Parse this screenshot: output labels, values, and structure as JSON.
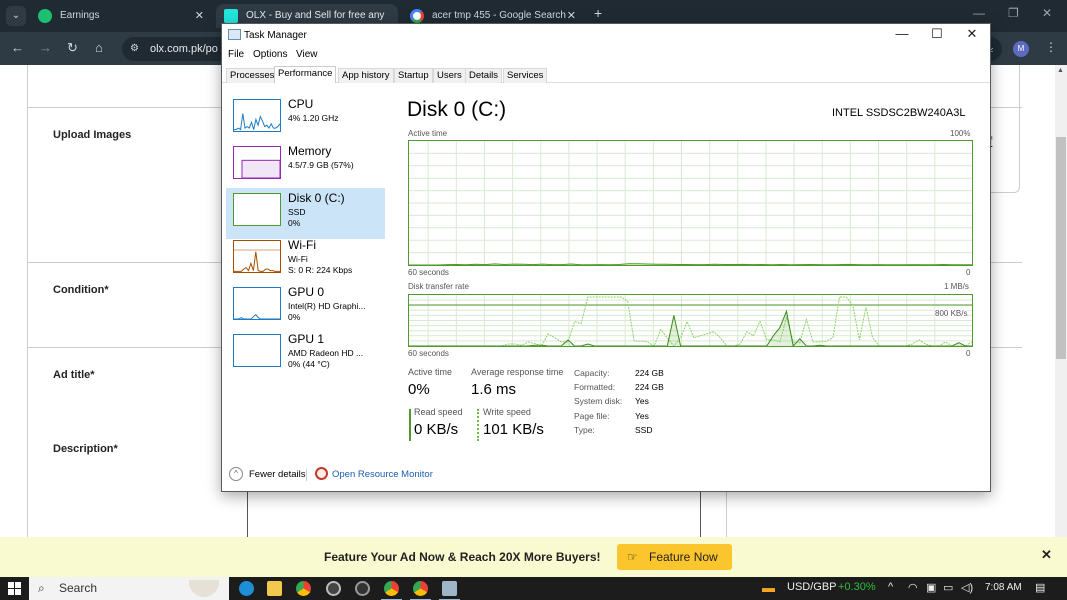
{
  "browser": {
    "tabs": [
      {
        "title": "Earnings",
        "favicon": "fiverr-icon",
        "color": "#1dbf73"
      },
      {
        "title": "OLX - Buy and Sell for free any",
        "favicon": "olx-icon",
        "color": "#23e5db"
      },
      {
        "title": "acer tmp 455 - Google Search",
        "favicon": "google-icon",
        "color": "#ffffff"
      }
    ],
    "new_tab": "+",
    "url": "olx.com.pk/po",
    "avatar_letter": "M",
    "tab_search_glyph": "⌄"
  },
  "page": {
    "labels": {
      "upload_images": "Upload Images",
      "condition": "Condition*",
      "ad_title": "Ad title*",
      "description": "Description*"
    },
    "partial_text": "f"
  },
  "banner": {
    "text": "Feature Your Ad Now & Reach 20X More Buyers!",
    "button": "Feature Now",
    "close": "✕"
  },
  "task_manager": {
    "title": "Task Manager",
    "menu": [
      "File",
      "Options",
      "View"
    ],
    "tabs": [
      "Processes",
      "Performance",
      "App history",
      "Startup",
      "Users",
      "Details",
      "Services"
    ],
    "active_tab": "Performance",
    "sidebar": [
      {
        "name": "CPU",
        "sub1": "4% 1.20 GHz",
        "sub2": "",
        "color": "#1e7bc3",
        "selected": false,
        "spark": [
          0.05,
          0.05,
          0.1,
          0.05,
          0.6,
          0.1,
          0.15,
          0.1,
          0.3,
          0.05,
          0.4,
          0.2,
          0.5,
          0.35,
          0.15,
          0.2,
          0.1,
          0.25,
          0.1,
          0.1,
          0.15,
          0.25
        ]
      },
      {
        "name": "Memory",
        "sub1": "4.5/7.9 GB (57%)",
        "sub2": "",
        "color": "#9528b4",
        "selected": false,
        "spark": [
          0.57
        ]
      },
      {
        "name": "Disk 0 (C:)",
        "sub1": "SSD",
        "sub2": "0%",
        "color": "#4e9a2a",
        "selected": true,
        "spark": [
          0
        ]
      },
      {
        "name": "Wi-Fi",
        "sub1": "Wi-Fi",
        "sub2": "S: 0 R: 224 Kbps",
        "color": "#a74f01",
        "selected": false,
        "spark": [
          0.02,
          0.02,
          0.02,
          0.02,
          0.1,
          0.15,
          0.05,
          0.3,
          0.05,
          0.7,
          0.05,
          0.02,
          0.02,
          0.1,
          0.1,
          0.05,
          0.05,
          0.02,
          0.02,
          0.02
        ]
      },
      {
        "name": "GPU 0",
        "sub1": "Intel(R) HD Graphi...",
        "sub2": "0%",
        "color": "#1e7bc3",
        "selected": false,
        "spark": [
          0,
          0,
          0,
          0.05,
          0,
          0,
          0,
          0,
          0.08,
          0.15,
          0.05,
          0,
          0,
          0,
          0,
          0,
          0,
          0,
          0,
          0
        ]
      },
      {
        "name": "GPU 1",
        "sub1": "AMD Radeon HD ...",
        "sub2": "0% (44 °C)",
        "color": "#1e7bc3",
        "selected": false,
        "spark": [
          0
        ]
      }
    ],
    "detail": {
      "title": "Disk 0 (C:)",
      "model": "INTEL SSDSC2BW240A3L",
      "active_time_label": "Active time",
      "active_time_max": "100%",
      "time_span_label": "60 seconds",
      "min_label": "0",
      "transfer_label": "Disk transfer rate",
      "transfer_max": "1 MB/s",
      "transfer_mid": "800 KB/s",
      "active_series": [
        0,
        0,
        0,
        0,
        0.3,
        0.4,
        0.2,
        0.6,
        0.3,
        0.9,
        0.4,
        0.7,
        0.6,
        0.3,
        0.7,
        0.3,
        0.3,
        0.8,
        0.2,
        0.2,
        0.3,
        0.2,
        0.4,
        1.0,
        1.0,
        0.8,
        0.6,
        0.6,
        0.4,
        0.4,
        0.3,
        0.3,
        0.6,
        0.4,
        0.4,
        0.5,
        0.3,
        0.4,
        0.2,
        0.4,
        0.2,
        0.3,
        0.4,
        0.3,
        0.2,
        0.3,
        0.5,
        0.3,
        0.2,
        0.3,
        0.2,
        0.2,
        0.2,
        0.3,
        0.2,
        0.2,
        0.4,
        0.2,
        0.2,
        0.2
      ],
      "read_series": [
        0,
        0,
        0,
        0,
        0,
        0,
        0,
        0,
        0,
        0,
        0,
        0,
        0,
        0,
        0,
        0,
        0,
        0,
        0,
        0.02,
        0.02,
        0,
        0,
        0,
        0.15,
        0,
        0,
        0.05,
        0,
        0,
        0,
        0,
        0,
        0,
        0,
        0,
        0,
        0,
        0,
        0,
        0.75,
        0,
        0,
        0,
        0,
        0,
        0,
        0,
        0,
        0,
        0,
        0,
        0,
        0,
        0,
        0.25,
        0.45,
        0.85,
        0,
        0.18,
        0,
        0,
        0.02,
        0,
        0,
        0,
        0,
        0,
        0,
        0,
        0,
        0,
        0,
        0,
        0,
        0,
        0,
        0,
        0,
        0,
        0,
        0,
        0,
        0.08,
        0,
        0
      ],
      "write_series": [
        0,
        0,
        0,
        0,
        0,
        0,
        0,
        0,
        0,
        0,
        0,
        0,
        0,
        0,
        0,
        0.05,
        0.05,
        0.02,
        0.1,
        0.06,
        0.0,
        0.3,
        0.2,
        0.1,
        0.1,
        0.6,
        0.55,
        1.2,
        1.2,
        1.2,
        1.2,
        1.2,
        1.2,
        1.1,
        0.12,
        0.12,
        0.1,
        0.0,
        0.4,
        0.2,
        0.0,
        0.2,
        0.6,
        0.2,
        0.25,
        0.3,
        0.35,
        0.2,
        0.0,
        0.0,
        0.05,
        0.35,
        0.25,
        0.6,
        0.15,
        0.15,
        0.1,
        0.7,
        0.1,
        0.08,
        0.65,
        0.1,
        0.1,
        0.12,
        0.2,
        1.2,
        1.2,
        1.0,
        0.15,
        0.95,
        0.2,
        0.0,
        0.0,
        0.0,
        0.0,
        0.0,
        0.05,
        0.15,
        0.05,
        0.0,
        0.0,
        0.1,
        0.0,
        0.0,
        0.0,
        0.1
      ],
      "stats": {
        "active_time_label": "Active time",
        "active_time_value": "0%",
        "avg_response_label": "Average response time",
        "avg_response_value": "1.6 ms",
        "read_label": "Read speed",
        "read_value": "0 KB/s",
        "write_label": "Write speed",
        "write_value": "101 KB/s"
      },
      "properties": [
        {
          "key": "Capacity:",
          "value": "224 GB"
        },
        {
          "key": "Formatted:",
          "value": "224 GB"
        },
        {
          "key": "System disk:",
          "value": "Yes"
        },
        {
          "key": "Page file:",
          "value": "Yes"
        },
        {
          "key": "Type:",
          "value": "SSD"
        }
      ]
    },
    "footer": {
      "fewer_details": "Fewer details",
      "open_resource_monitor": "Open Resource Monitor"
    }
  },
  "taskbar": {
    "search_placeholder": "Search",
    "ticker": "USD/GBP",
    "ticker_change": "+0.30%",
    "ticker_color": "#2fbf3a",
    "time": "7:08 AM"
  }
}
